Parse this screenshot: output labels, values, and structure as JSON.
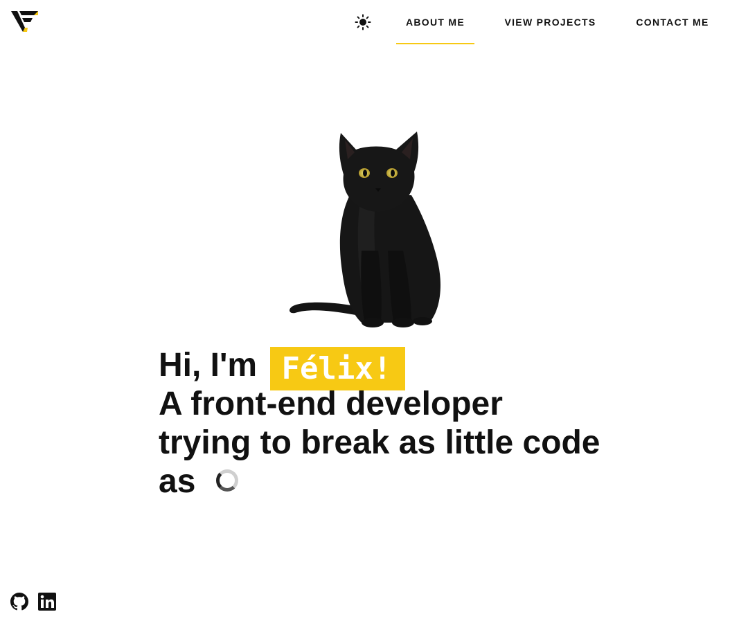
{
  "header": {
    "logo_icon": "vf-logo-icon",
    "theme_toggle_icon": "sun-icon",
    "nav": [
      {
        "label": "ABOUT ME",
        "active": true
      },
      {
        "label": "VIEW PROJECTS",
        "active": false
      },
      {
        "label": "CONTACT ME",
        "active": false
      }
    ]
  },
  "hero": {
    "image": "black-cat-photo",
    "greeting": "Hi, I'm",
    "name": "Félix!",
    "line2": "A front-end developer",
    "line3": "trying to break as little code",
    "line4": "as",
    "loading_icon": "loading-spinner-icon"
  },
  "social": [
    {
      "icon": "github-icon"
    },
    {
      "icon": "linkedin-icon"
    }
  ],
  "colors": {
    "accent": "#f7c914",
    "text": "#111111",
    "background": "#ffffff"
  }
}
